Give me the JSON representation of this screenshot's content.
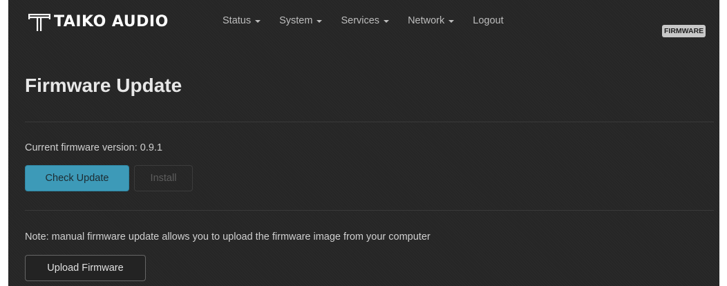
{
  "brand": {
    "name": "TAIKO AUDIO"
  },
  "nav": {
    "items": [
      {
        "label": "Status",
        "dropdown": true
      },
      {
        "label": "System",
        "dropdown": true
      },
      {
        "label": "Services",
        "dropdown": true
      },
      {
        "label": "Network",
        "dropdown": true
      },
      {
        "label": "Logout",
        "dropdown": false
      }
    ]
  },
  "badge": "FIRMWARE",
  "page": {
    "title": "Firmware Update",
    "current_version_label": "Current firmware version: 0.9.1",
    "check_update_label": "Check Update",
    "install_label": "Install",
    "note": "Note: manual firmware update allows you to upload the firmware image from your computer",
    "upload_label": "Upload Firmware"
  },
  "colors": {
    "background": "#262626",
    "primary": "#3d9ab8",
    "badge_bg": "#c8c8c8"
  },
  "icons": {
    "logo": "taiko-audio-logo-icon",
    "dropdown": "caret-down-icon"
  }
}
